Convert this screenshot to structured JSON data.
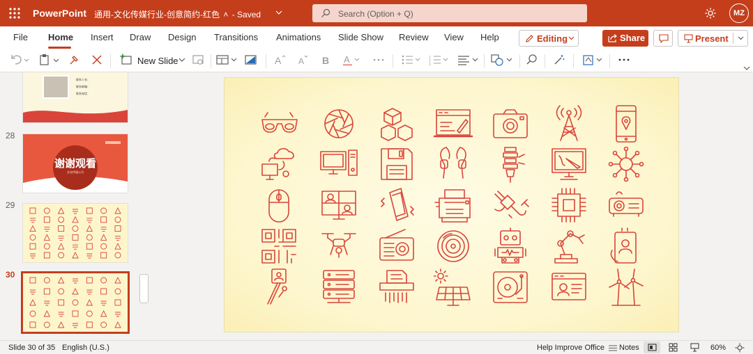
{
  "app": {
    "name": "PowerPoint",
    "document_title": "通用-文化传媒行业-创意简约-红色",
    "save_status": "- Saved",
    "user_initials": "MZ"
  },
  "search": {
    "placeholder": "Search (Option + Q)"
  },
  "tabs": [
    {
      "label": "File",
      "active": false
    },
    {
      "label": "Home",
      "active": true
    },
    {
      "label": "Insert",
      "active": false
    },
    {
      "label": "Draw",
      "active": false
    },
    {
      "label": "Design",
      "active": false
    },
    {
      "label": "Transitions",
      "active": false
    },
    {
      "label": "Animations",
      "active": false
    },
    {
      "label": "Slide Show",
      "active": false
    },
    {
      "label": "Review",
      "active": false
    },
    {
      "label": "View",
      "active": false
    },
    {
      "label": "Help",
      "active": false
    }
  ],
  "buttons": {
    "editing": "Editing",
    "share": "Share",
    "present": "Present",
    "new_slide": "New Slide"
  },
  "slides_panel": {
    "thumbnails": [
      {
        "number": "",
        "subtitle_lines": [
          "联系人名：",
          "联系邮箱：",
          "联系电话："
        ]
      },
      {
        "number": "28",
        "heading": "谢谢观看",
        "subheading": "文化传媒公司"
      },
      {
        "number": "29"
      },
      {
        "number": "30",
        "active": true
      }
    ]
  },
  "status": {
    "slide_position": "Slide 30 of 35",
    "language": "English (U.S.)",
    "help_improve": "Help Improve Office",
    "notes": "Notes",
    "zoom": "60%"
  },
  "slide": {
    "icons": [
      [
        "3d-glasses-icon",
        "aperture-icon",
        "cubes-icon",
        "web-design-icon",
        "camera-icon",
        "radio-tower-icon",
        "map-phone-icon"
      ],
      [
        "cloud-computer-icon",
        "desktop-pc-icon",
        "floppy-disk-icon",
        "earphones-icon",
        "led-bulb-icon",
        "drawing-monitor-icon",
        "neural-network-icon"
      ],
      [
        "mouse-icon",
        "video-call-icon",
        "vibrating-phone-icon",
        "printer-icon",
        "plug-icon",
        "cpu-chip-icon",
        "projector-icon"
      ],
      [
        "qr-code-icon",
        "drone-icon",
        "old-radio-icon",
        "vinyl-record-icon",
        "robot-icon",
        "robot-arm-icon",
        "phone-user-icon"
      ],
      [
        "selfie-stick-icon",
        "server-rack-icon",
        "paper-shredder-icon",
        "solar-panel-icon",
        "turntable-icon",
        "video-player-icon",
        "wind-turbine-icon"
      ]
    ],
    "stroke_color": "#d9453a"
  },
  "colors": {
    "brand": "#c43e1c",
    "slide_bg": "#fdf6cd"
  }
}
